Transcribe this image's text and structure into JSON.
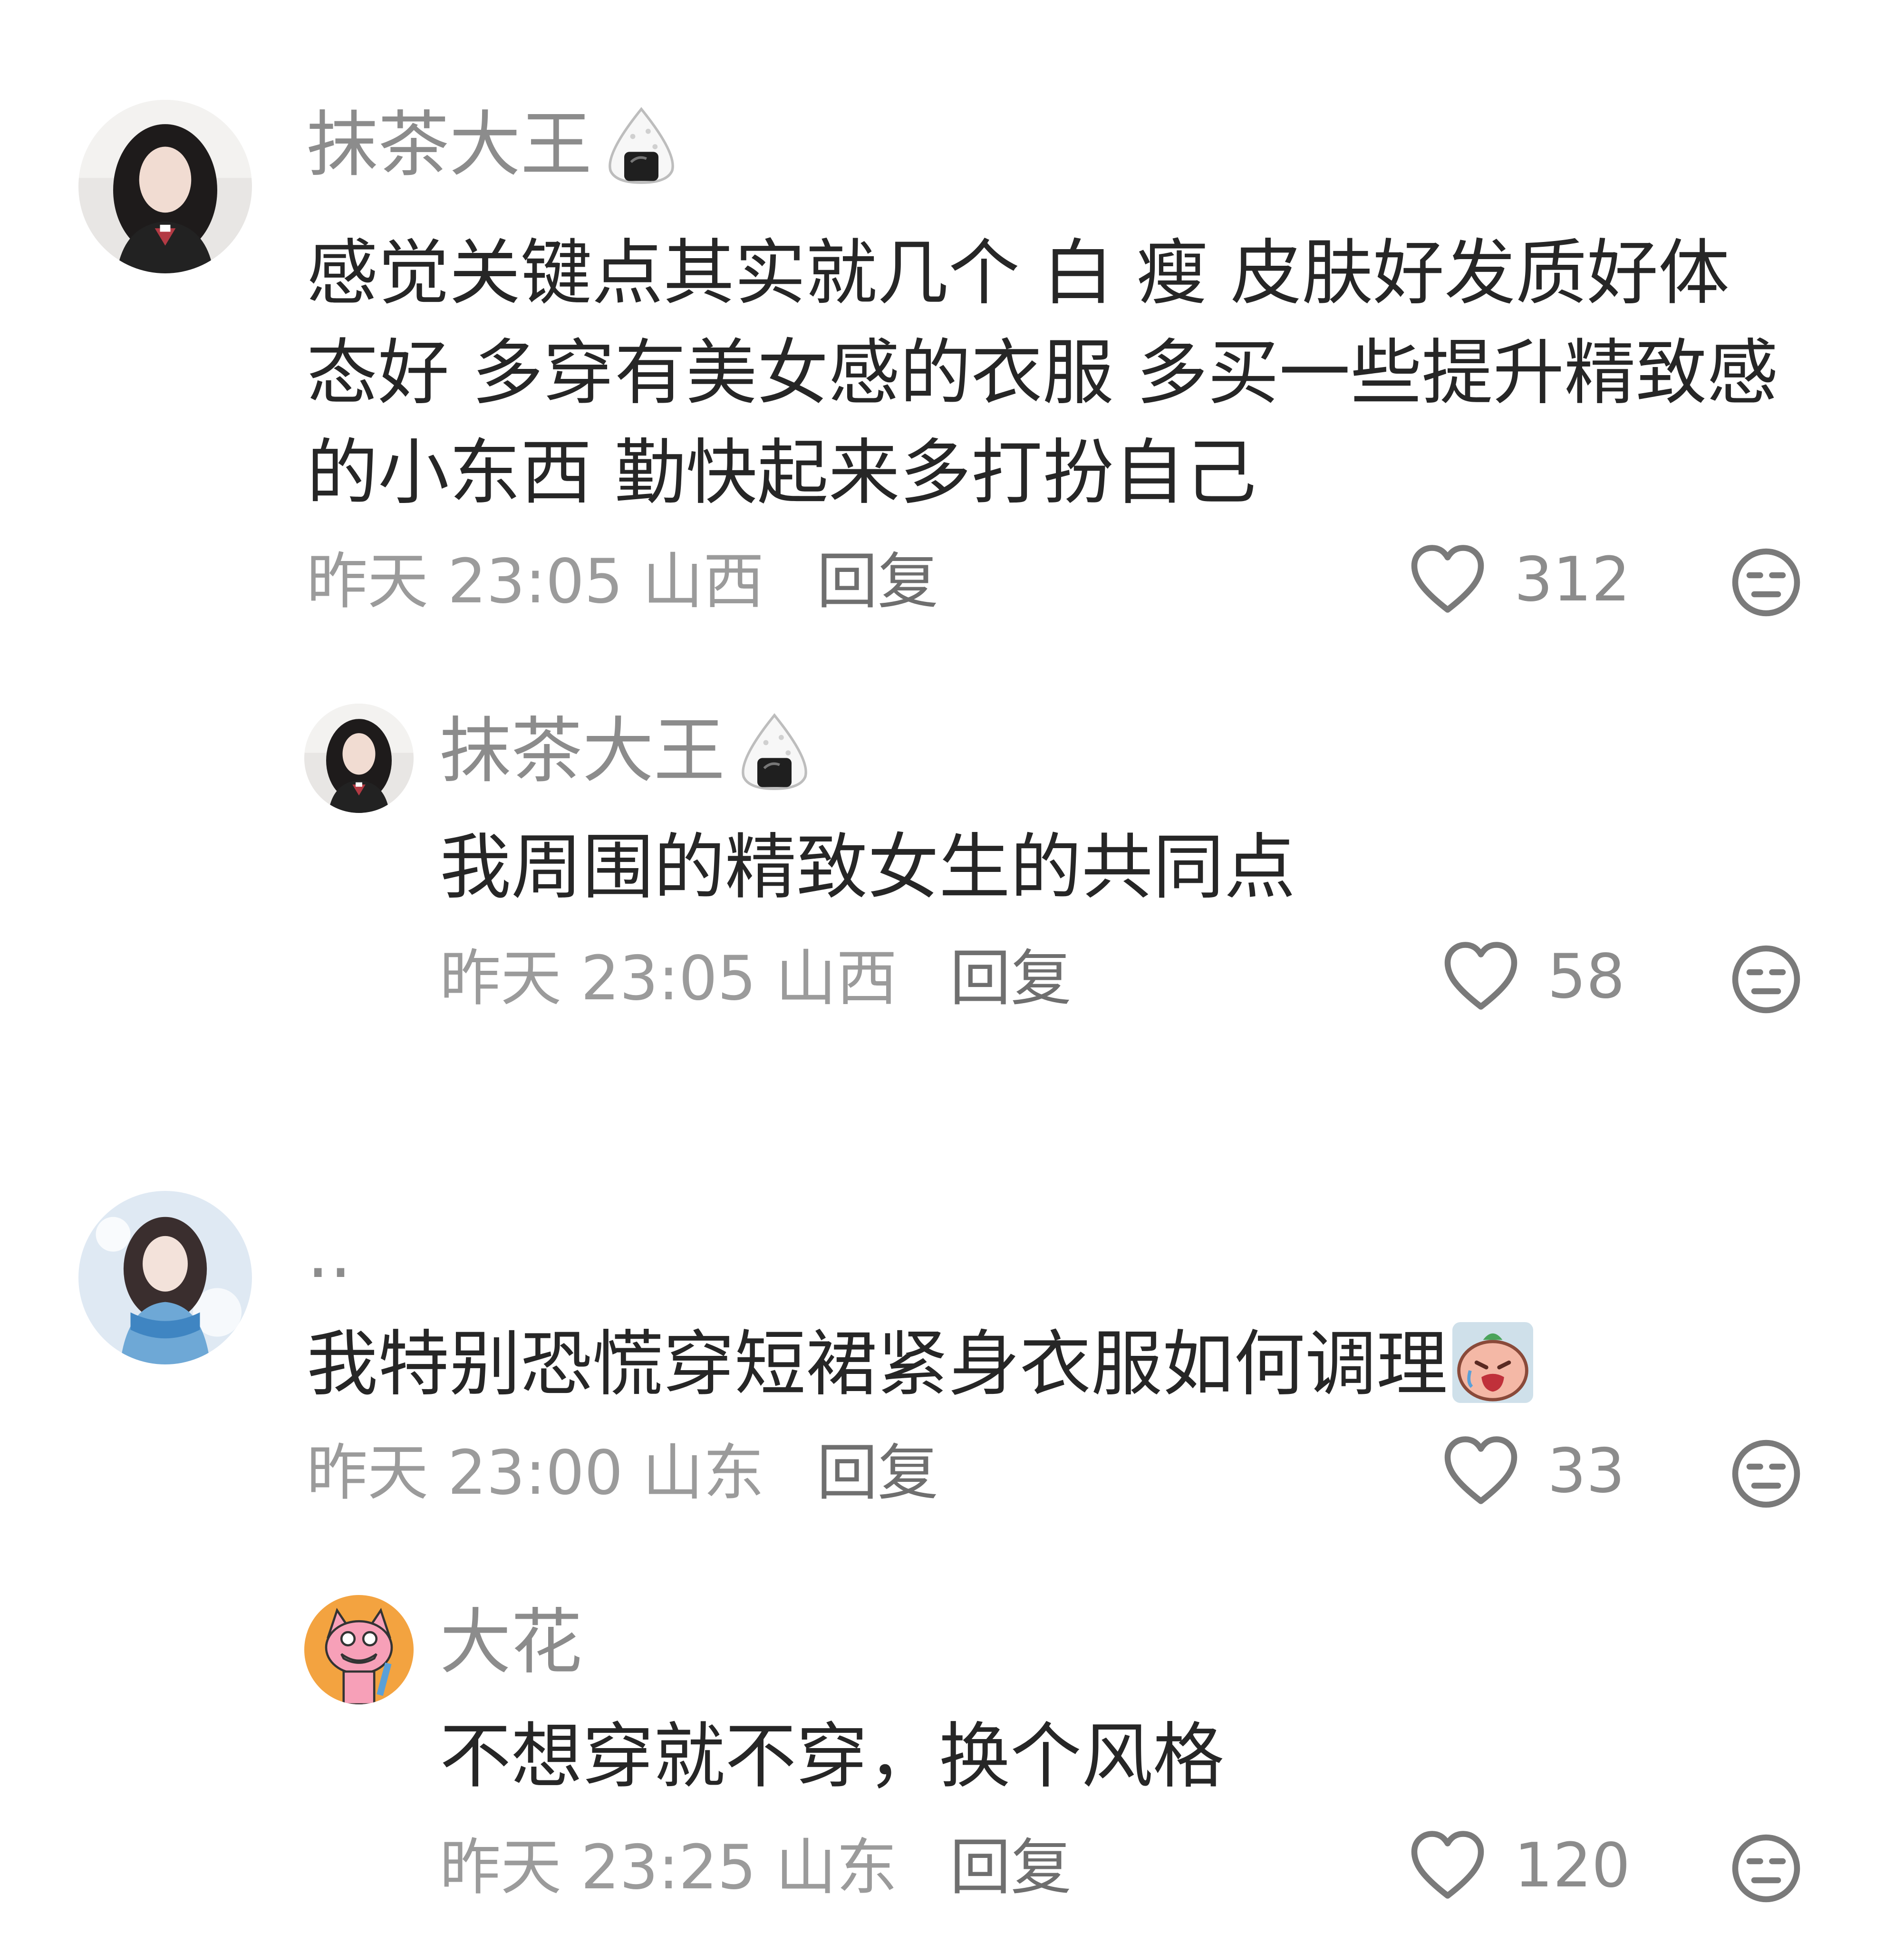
{
  "comments": [
    {
      "username": "抹茶大王",
      "text_lines": [
        "感觉关键点其实就几个 白 瘦 皮肤好发质好体",
        "态好 多穿有美女感的衣服 多买一些提升精致感",
        "的小东西 勤快起来多打扮自己"
      ],
      "time": "昨天 23:05",
      "location": "山西",
      "reply_label": "回复",
      "likes": "312",
      "badge_icon": "rice-ball-icon"
    },
    {
      "username": "抹茶大王",
      "text_lines": [
        "我周围的精致女生的共同点"
      ],
      "time": "昨天 23:05",
      "location": "山西",
      "reply_label": "回复",
      "likes": "58",
      "badge_icon": "rice-ball-icon"
    },
    {
      "username": "..",
      "text_lines": [
        "我特别恐慌穿短裙紧身衣服如何调理"
      ],
      "time": "昨天 23:00",
      "location": "山东",
      "reply_label": "回复",
      "likes": "33",
      "inline_emoji": "crying-face-emoji"
    },
    {
      "username": "大花",
      "text_lines": [
        "不想穿就不穿，换个风格"
      ],
      "time": "昨天 23:25",
      "location": "山东",
      "reply_label": "回复",
      "likes": "120"
    }
  ],
  "colors": {
    "username": "#8c8c8c",
    "text": "#262626",
    "meta": "#9b9b9b",
    "icon": "#7a7a7a"
  }
}
